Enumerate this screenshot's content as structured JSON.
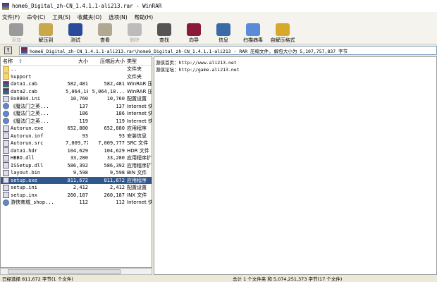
{
  "window": {
    "title": "home6_Digital_zh-CN_1.4.1.1-ali213.rar - WinRAR"
  },
  "menu": [
    "文件(F)",
    "命令(C)",
    "工具(S)",
    "收藏夹(O)",
    "选项(N)",
    "帮助(H)"
  ],
  "toolbar": [
    {
      "label": "添加",
      "icon": "add-icon",
      "color": "#9a9a9a",
      "disabled": true
    },
    {
      "label": "解压到",
      "icon": "extract-icon",
      "color": "#c8a84a"
    },
    {
      "label": "测试",
      "icon": "test-icon",
      "color": "#2a4a9a"
    },
    {
      "label": "查看",
      "icon": "view-icon",
      "color": "#b0a890"
    },
    {
      "label": "删除",
      "icon": "delete-icon",
      "color": "#bbbbbb",
      "disabled": true
    },
    {
      "label": "查找",
      "icon": "find-icon",
      "color": "#555555"
    },
    {
      "label": "向导",
      "icon": "wizard-icon",
      "color": "#8b1a3a"
    },
    {
      "label": "信息",
      "icon": "info-icon",
      "color": "#3a6aa8"
    },
    {
      "label": "扫描病毒",
      "icon": "scan-virus-icon",
      "color": "#5a8ad8"
    },
    {
      "label": "自解压格式",
      "icon": "sfx-icon",
      "color": "#d8a82a"
    }
  ],
  "address": {
    "path": "home6_Digital_zh-CN_1.4.1.1-ali213.rar\\home6_Digital_zh-CN_1.4.1.1-ali213 - RAR 压缩文件, 解包大小为 5,107,757,837 字节"
  },
  "columns": {
    "name": "名称",
    "size": "大小",
    "packed": "压缩后大小",
    "type": "类型"
  },
  "files": [
    {
      "name": "..",
      "size": "",
      "packed": "",
      "type": "文件夹",
      "icon": "folder"
    },
    {
      "name": "Support",
      "size": "",
      "packed": "",
      "type": "文件夹",
      "icon": "folder"
    },
    {
      "name": "data1.cab",
      "size": "582,481",
      "packed": "582,481",
      "type": "WinRAR 压缩文件",
      "icon": "rar"
    },
    {
      "name": "data2.cab",
      "size": "5,064,18...",
      "packed": "5,064,18...",
      "type": "WinRAR 压缩文件",
      "icon": "rar"
    },
    {
      "name": "0x0804.ini",
      "size": "10,760",
      "packed": "10,760",
      "type": "配置设置",
      "icon": "file"
    },
    {
      "name": "《魔法门之英...",
      "size": "137",
      "packed": "137",
      "type": "Internet 快捷方式",
      "icon": "ie"
    },
    {
      "name": "《魔法门之英...",
      "size": "186",
      "packed": "186",
      "type": "Internet 快捷方式",
      "icon": "ie"
    },
    {
      "name": "《魔法门之英...",
      "size": "119",
      "packed": "119",
      "type": "Internet 快捷方式",
      "icon": "ie"
    },
    {
      "name": "Autorun.exe",
      "size": "652,880",
      "packed": "652,880",
      "type": "应用程序",
      "icon": "file"
    },
    {
      "name": "Autorun.inf",
      "size": "93",
      "packed": "93",
      "type": "安装信息",
      "icon": "file"
    },
    {
      "name": "Autorun.src",
      "size": "7,009,777",
      "packed": "7,009,777",
      "type": "SRC 文件",
      "icon": "file"
    },
    {
      "name": "data1.hdr",
      "size": "104,629",
      "packed": "104,629",
      "type": "HDR 文件",
      "icon": "file"
    },
    {
      "name": "HBBO.dll",
      "size": "33,280",
      "packed": "33,280",
      "type": "应用程序扩展",
      "icon": "file"
    },
    {
      "name": "ISSetup.dll",
      "size": "586,392",
      "packed": "586,392",
      "type": "应用程序扩展",
      "icon": "file"
    },
    {
      "name": "layout.bin",
      "size": "9,598",
      "packed": "9,598",
      "type": "BIN 文件",
      "icon": "file"
    },
    {
      "name": "setup.exe",
      "size": "811,672",
      "packed": "811,672",
      "type": "应用程序",
      "icon": "file",
      "selected": true
    },
    {
      "name": "setup.ini",
      "size": "2,412",
      "packed": "2,412",
      "type": "配置设置",
      "icon": "file"
    },
    {
      "name": "setup.inx",
      "size": "260,187",
      "packed": "260,187",
      "type": "INX 文件",
      "icon": "file"
    },
    {
      "name": "游侠商城_shop...",
      "size": "112",
      "packed": "112",
      "type": "Internet 快捷方式",
      "icon": "ie"
    }
  ],
  "comment": [
    "游侠首页：http://www.ali213.net",
    "游侠论坛：http://game.ali213.net"
  ],
  "status": {
    "left": "已经选择 811,672 字节(1 个文件)",
    "right": "总计 1 个文件夹 和 5,074,251,373 字节(17 个文件)"
  }
}
